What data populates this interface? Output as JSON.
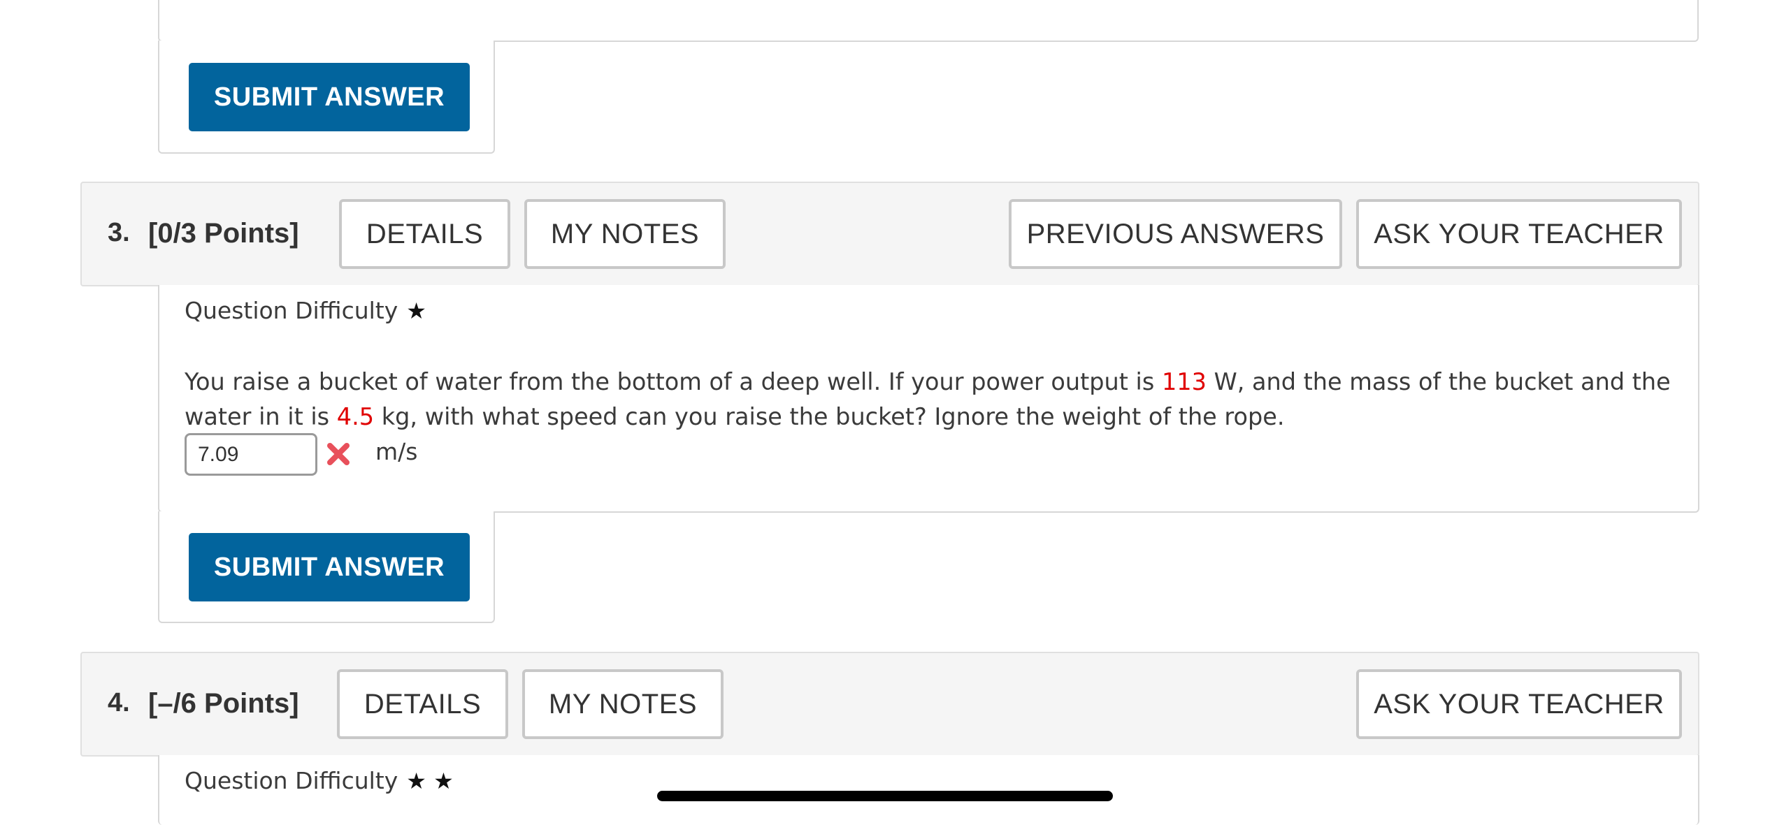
{
  "previous_question": {
    "submit_label": "SUBMIT ANSWER"
  },
  "question3": {
    "number": "3.",
    "points": "[0/3 Points]",
    "details_label": "DETAILS",
    "notes_label": "MY NOTES",
    "previous_answers_label": "PREVIOUS ANSWERS",
    "ask_teacher_label": "ASK YOUR TEACHER",
    "difficulty_label": "Question Difficulty",
    "difficulty_stars": "★",
    "text_part1": "You raise a bucket of water from the bottom of a deep well. If your power output is ",
    "power_value": "113",
    "text_part2": " W, and the mass of the bucket and the water in it is ",
    "mass_value": "4.5",
    "text_part3": " kg, with what speed can you raise the bucket? Ignore the weight of the rope.",
    "answer_value": "7.09",
    "answer_status_icon": "incorrect-x-icon",
    "unit": "m/s",
    "submit_label": "SUBMIT ANSWER"
  },
  "question4": {
    "number": "4.",
    "points": "[–/6 Points]",
    "details_label": "DETAILS",
    "notes_label": "MY NOTES",
    "ask_teacher_label": "ASK YOUR TEACHER",
    "difficulty_label": "Question Difficulty",
    "difficulty_stars": "★ ★"
  },
  "colors": {
    "submit_button": "#02649d",
    "highlight_value": "#e00000",
    "incorrect_icon": "#e8505b"
  }
}
